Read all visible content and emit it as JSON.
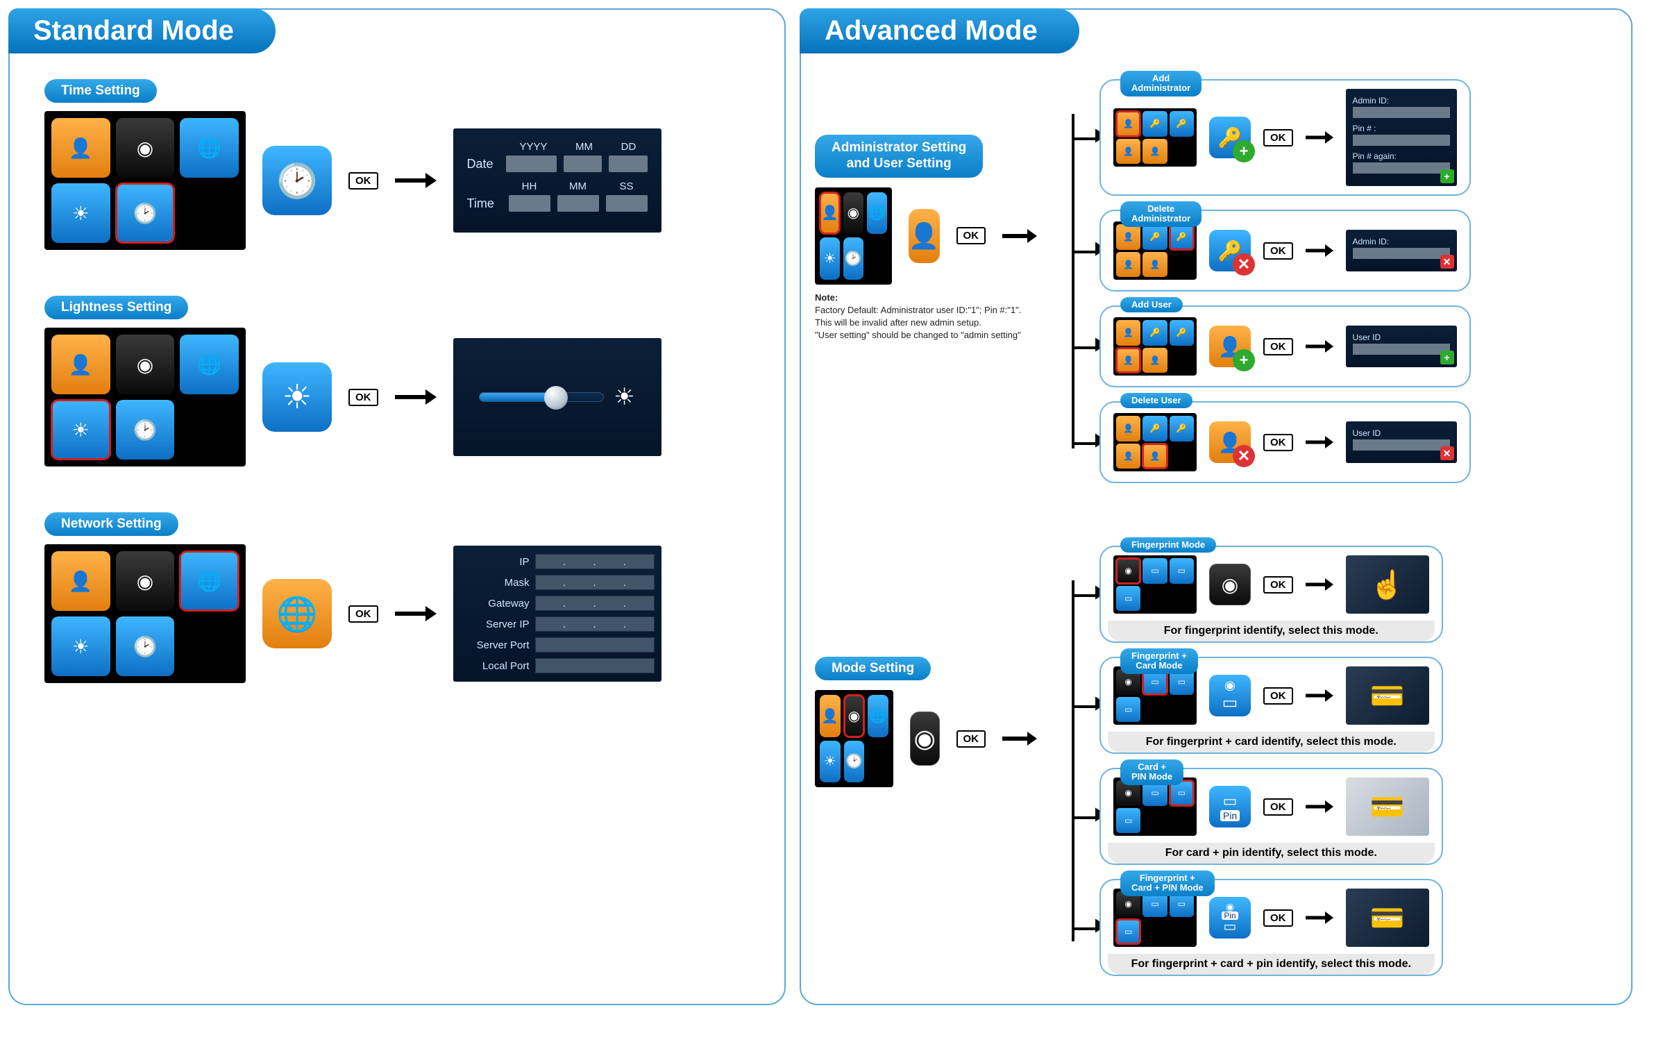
{
  "left": {
    "title": "Standard Mode",
    "sections": {
      "time": {
        "label": "Time Setting",
        "ok": "OK",
        "result": {
          "date_label": "Date",
          "time_label": "Time",
          "cols_date": [
            "YYYY",
            "MM",
            "DD"
          ],
          "cols_time": [
            "HH",
            "MM",
            "SS"
          ]
        }
      },
      "lightness": {
        "label": "Lightness Setting",
        "ok": "OK"
      },
      "network": {
        "label": "Network Setting",
        "ok": "OK",
        "rows": [
          "IP",
          "Mask",
          "Gateway",
          "Server IP",
          "Server Port",
          "Local Port"
        ]
      }
    }
  },
  "right": {
    "title": "Advanced Mode",
    "admin": {
      "label": "Administrator Setting\nand User  Setting",
      "ok": "OK",
      "note_title": "Note:",
      "note_lines": [
        "Factory Default: Administrator user ID:\"1\"; Pin #:\"1\".",
        "This will be invalid after new admin setup.",
        "\"User setting\" should be changed to \"admin setting\""
      ],
      "branches": {
        "add_admin": {
          "label": "Add\nAdministrator",
          "ok": "OK",
          "form": [
            "Admin ID:",
            "Pin # :",
            "Pin # again:"
          ],
          "badge": "add"
        },
        "del_admin": {
          "label": "Delete\nAdministrator",
          "ok": "OK",
          "form": [
            "Admin ID:"
          ],
          "badge": "del"
        },
        "add_user": {
          "label": "Add User",
          "ok": "OK",
          "form": [
            "User ID"
          ],
          "badge": "add"
        },
        "del_user": {
          "label": "Delete User",
          "ok": "OK",
          "form": [
            "User ID"
          ],
          "badge": "del"
        }
      }
    },
    "mode": {
      "label": "Mode Setting",
      "ok": "OK",
      "branches": {
        "fp": {
          "label": "Fingerprint Mode",
          "ok": "OK",
          "caption": "For fingerprint  identify, select this mode."
        },
        "fp_card": {
          "label": "Fingerprint +\nCard Mode",
          "ok": "OK",
          "caption": "For fingerprint + card identify, select this mode."
        },
        "card_pin": {
          "label": "Card +\nPIN Mode",
          "ok": "OK",
          "pin_text": "Pin",
          "caption": "For card + pin identify, select this mode."
        },
        "fp_card_pin": {
          "label": "Fingerprint +\nCard + PIN Mode",
          "ok": "OK",
          "pin_text": "Pin",
          "caption": "For fingerprint + card + pin identify, select this mode."
        }
      }
    }
  },
  "icons": {
    "user_key": "👤",
    "fingerprint": "◉",
    "globe_pc": "🌐",
    "brightness": "☀",
    "clock": "🕑",
    "card": "▭",
    "card_pin": "▭",
    "pin": "Pin"
  }
}
